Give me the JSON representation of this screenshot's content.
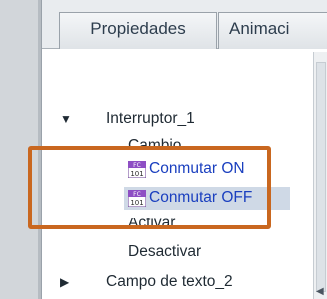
{
  "tabs": {
    "properties": "Propiedades",
    "animations": "Animaci"
  },
  "tree": {
    "items": [
      {
        "label": "Interruptor_1",
        "expanded": true
      },
      {
        "label": "Cambio"
      },
      {
        "label": "Conmutar ON",
        "icon": "function-block-icon"
      },
      {
        "label": "Conmutar OFF",
        "icon": "function-block-icon",
        "selected": true
      },
      {
        "label": "Activar"
      },
      {
        "label": "Desactivar"
      },
      {
        "label": "Campo de texto_2",
        "expanded": false
      }
    ]
  },
  "colors": {
    "highlight_box": "#c9671f",
    "selected_row": "#cfd9e6",
    "link_text": "#1a3fbf"
  }
}
